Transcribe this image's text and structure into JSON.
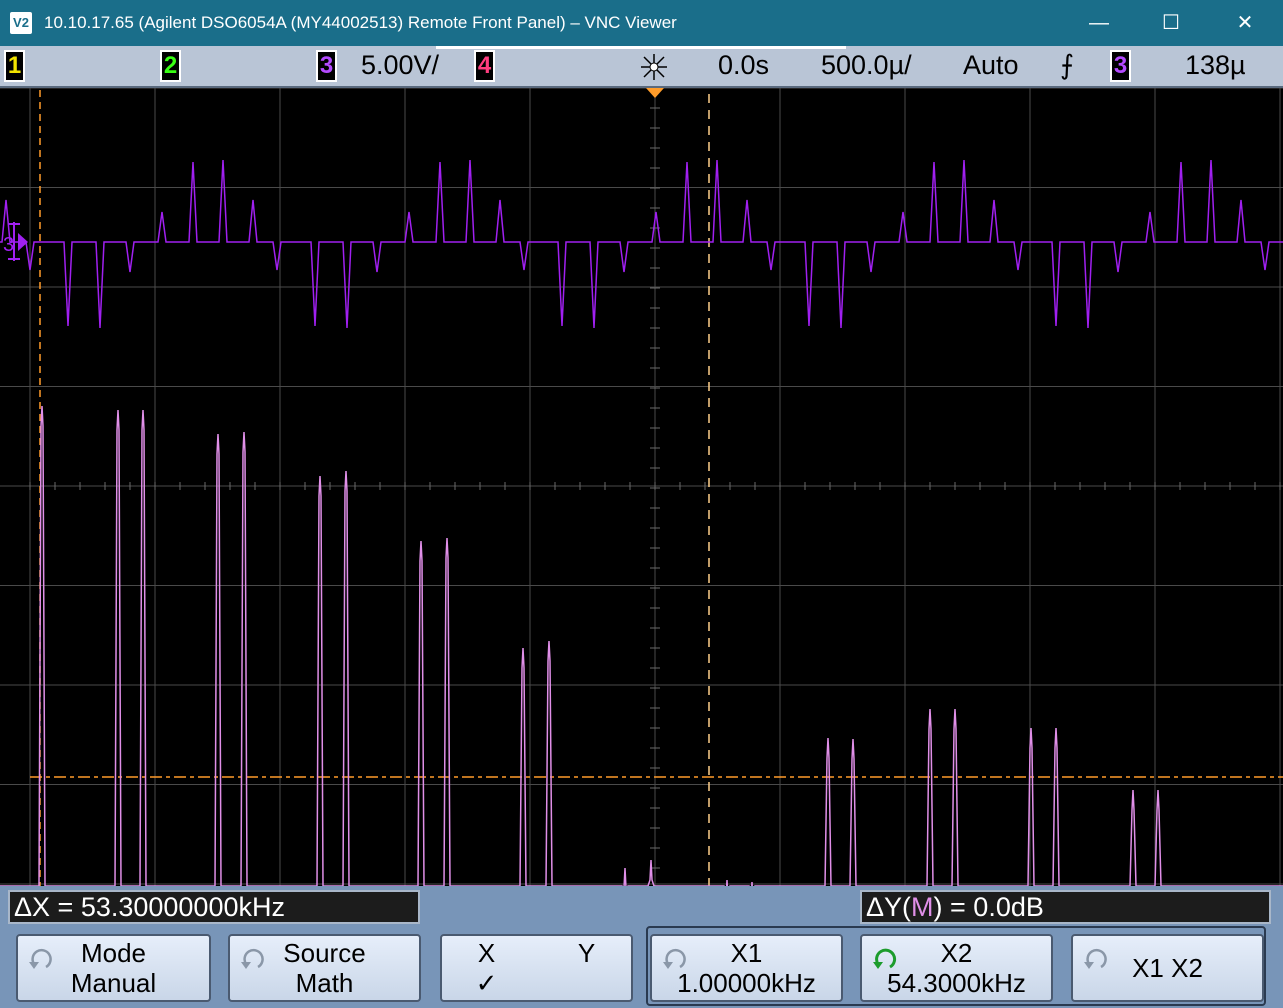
{
  "window": {
    "icon_label": "V2",
    "title": "10.10.17.65 (Agilent DSO6054A (MY44002513) Remote Front Panel) – VNC Viewer",
    "minimize_glyph": "—",
    "maximize_glyph": "☐",
    "close_glyph": "✕"
  },
  "status": {
    "ch1": "1",
    "ch2": "2",
    "ch3": "3",
    "ch3_scale": "5.00V/",
    "ch4": "4",
    "time_ref": "0.0s",
    "timebase": "500.0µ/",
    "trigger_mode": "Auto",
    "trigger_slope_glyph": "⨍",
    "trigger_source": "3",
    "trigger_level": "138µ"
  },
  "colors": {
    "ch1": "#f2e400",
    "ch2": "#39ff14",
    "ch3": "#a020f0",
    "ch4": "#ff3d7f",
    "math": "#e08fe8",
    "cursor": "#ff9c2a",
    "grid": "#555555"
  },
  "screen": {
    "ch3_marker": "3"
  },
  "readouts": {
    "delta_x": "ΔX = 53.30000000kHz",
    "delta_y_prefix": "ΔY(",
    "delta_y_source": "M",
    "delta_y_suffix": ") = 0.0dB"
  },
  "softkeys": {
    "mode": {
      "line1": "Mode",
      "line2": "Manual"
    },
    "source": {
      "line1": "Source",
      "line2": "Math"
    },
    "xy": {
      "x_label": "X",
      "y_label": "Y",
      "check": "✓"
    },
    "x1": {
      "line1": "X1",
      "line2": "1.00000kHz"
    },
    "x2": {
      "line1": "X2",
      "line2": "54.3000kHz"
    },
    "x1x2": {
      "line1": "X1 X2"
    }
  }
}
